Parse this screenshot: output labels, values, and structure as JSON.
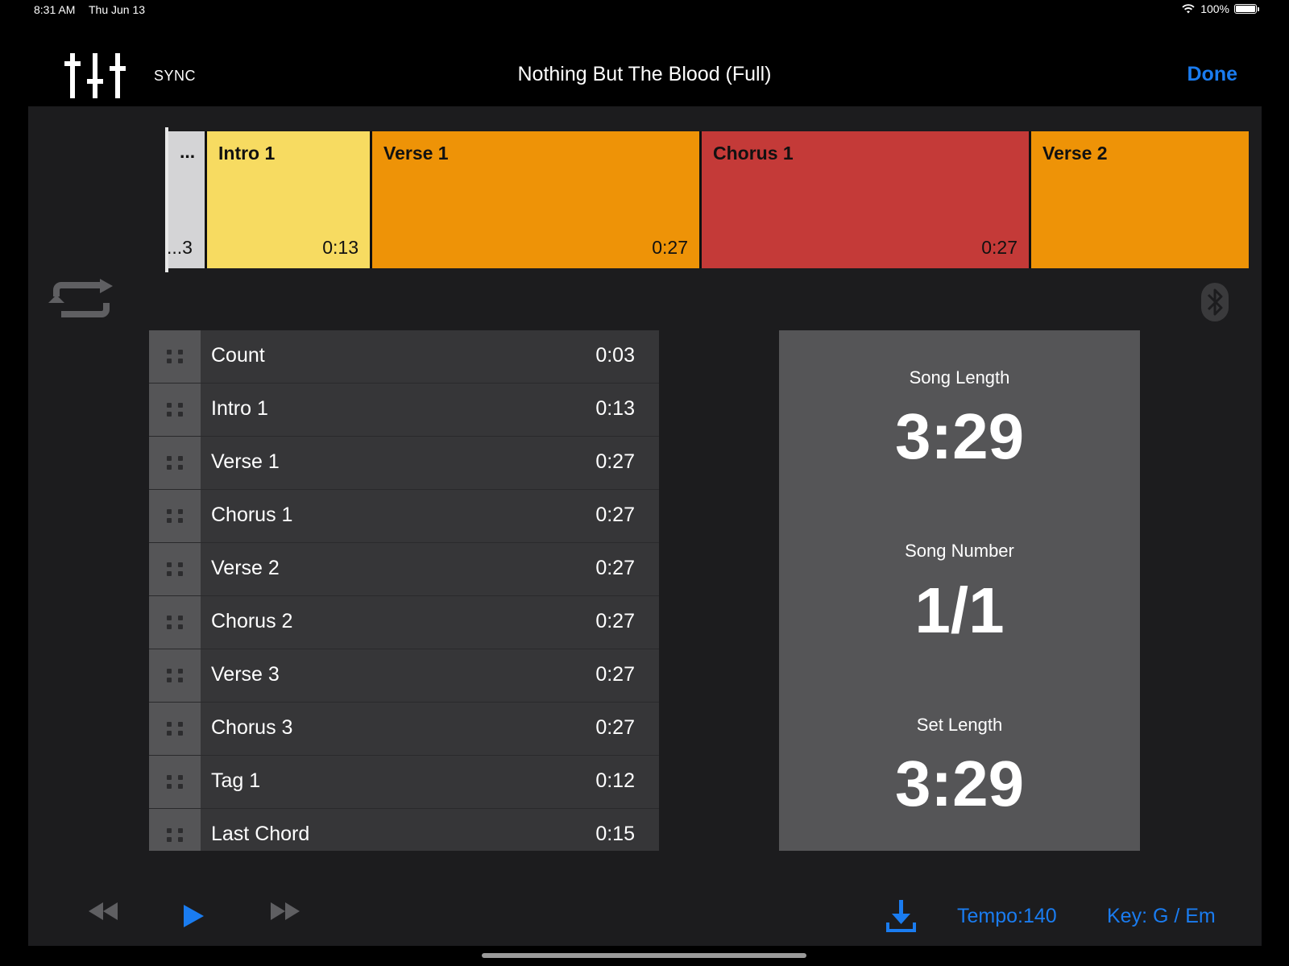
{
  "status_bar": {
    "time": "8:31 AM",
    "date": "Thu Jun 13",
    "battery": "100%"
  },
  "header": {
    "sync_label": "SYNC",
    "title": "Nothing But The Blood (Full)",
    "done_label": "Done"
  },
  "timeline": [
    {
      "label": "...",
      "time": "...3",
      "color": "#d4d4d6"
    },
    {
      "label": "Intro 1",
      "time": "0:13",
      "color": "#f7db61"
    },
    {
      "label": "Verse 1",
      "time": "0:27",
      "color": "#ee9307"
    },
    {
      "label": "Chorus 1",
      "time": "0:27",
      "color": "#c43a38"
    },
    {
      "label": "Verse 2",
      "time": "",
      "color": "#ee9307"
    }
  ],
  "sections": [
    {
      "name": "Count",
      "time": "0:03"
    },
    {
      "name": "Intro 1",
      "time": "0:13"
    },
    {
      "name": "Verse 1",
      "time": "0:27"
    },
    {
      "name": "Chorus 1",
      "time": "0:27"
    },
    {
      "name": "Verse 2",
      "time": "0:27"
    },
    {
      "name": "Chorus 2",
      "time": "0:27"
    },
    {
      "name": "Verse 3",
      "time": "0:27"
    },
    {
      "name": "Chorus 3",
      "time": "0:27"
    },
    {
      "name": "Tag 1",
      "time": "0:12"
    },
    {
      "name": "Last Chord",
      "time": "0:15"
    }
  ],
  "info": {
    "song_length_label": "Song Length",
    "song_length": "3:29",
    "song_number_label": "Song Number",
    "song_number": "1/1",
    "set_length_label": "Set Length",
    "set_length": "3:29"
  },
  "footer": {
    "tempo": "Tempo:140",
    "key": "Key: G / Em"
  },
  "icons": {
    "mixer": "mixer-icon",
    "loop": "loop-icon",
    "bluetooth": "bluetooth-icon",
    "rewind": "rewind-icon",
    "play": "play-icon",
    "fast_forward": "fast-forward-icon",
    "download": "download-icon"
  },
  "colors": {
    "accent": "#1a7cf0",
    "panel": "#1c1c1e",
    "list_row": "#363638",
    "info_panel": "#555557"
  }
}
